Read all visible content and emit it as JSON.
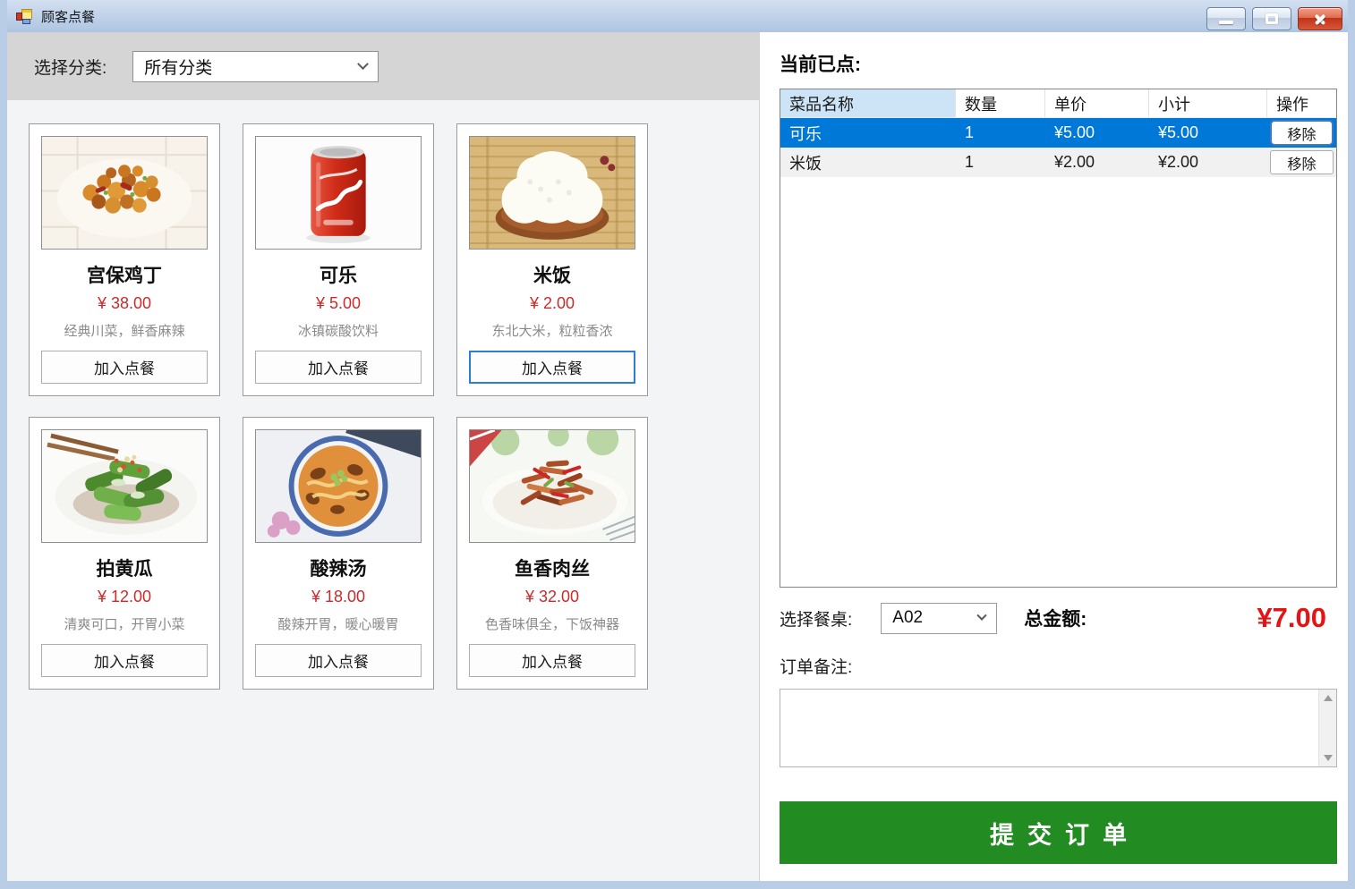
{
  "window": {
    "title": "顾客点餐"
  },
  "category_bar": {
    "label": "选择分类:",
    "selected_option": "所有分类"
  },
  "menu": {
    "add_button_label": "加入点餐",
    "items": [
      {
        "name": "宫保鸡丁",
        "price": "¥ 38.00",
        "desc": "经典川菜，鲜香麻辣",
        "image": "kungpao-chicken"
      },
      {
        "name": "可乐",
        "price": "¥ 5.00",
        "desc": "冰镇碳酸饮料",
        "image": "cola-can"
      },
      {
        "name": "米饭",
        "price": "¥ 2.00",
        "desc": "东北大米，粒粒香浓",
        "image": "steamed-rice"
      },
      {
        "name": "拍黄瓜",
        "price": "¥ 12.00",
        "desc": "清爽可口，开胃小菜",
        "image": "cucumber-salad"
      },
      {
        "name": "酸辣汤",
        "price": "¥ 18.00",
        "desc": "酸辣开胃，暖心暖胃",
        "image": "hot-sour-soup"
      },
      {
        "name": "鱼香肉丝",
        "price": "¥ 32.00",
        "desc": "色香味俱全，下饭神器",
        "image": "shredded-pork"
      }
    ]
  },
  "order_panel": {
    "heading": "当前已点:",
    "table": {
      "headers": [
        "菜品名称",
        "数量",
        "单价",
        "小计",
        "操作"
      ],
      "remove_button_label": "移除",
      "rows": [
        {
          "name": "可乐",
          "qty": "1",
          "unit_price": "¥5.00",
          "subtotal": "¥5.00",
          "selected": true
        },
        {
          "name": "米饭",
          "qty": "1",
          "unit_price": "¥2.00",
          "subtotal": "¥2.00",
          "selected": false
        }
      ]
    },
    "table_select": {
      "label": "选择餐桌:",
      "value": "A02"
    },
    "total": {
      "label": "总金额:",
      "value": "¥7.00"
    },
    "remarks": {
      "label": "订单备注:",
      "value": ""
    },
    "submit_button_label": "提交订单"
  },
  "colors": {
    "selected_row": "#0078D7",
    "price_red": "#CC2A2A",
    "total_red": "#E21414",
    "submit_green": "#228B22",
    "header_highlight": "#CDE3F6",
    "titlebar_top": "#D3DFF0",
    "titlebar_bottom": "#AEC5E2"
  }
}
